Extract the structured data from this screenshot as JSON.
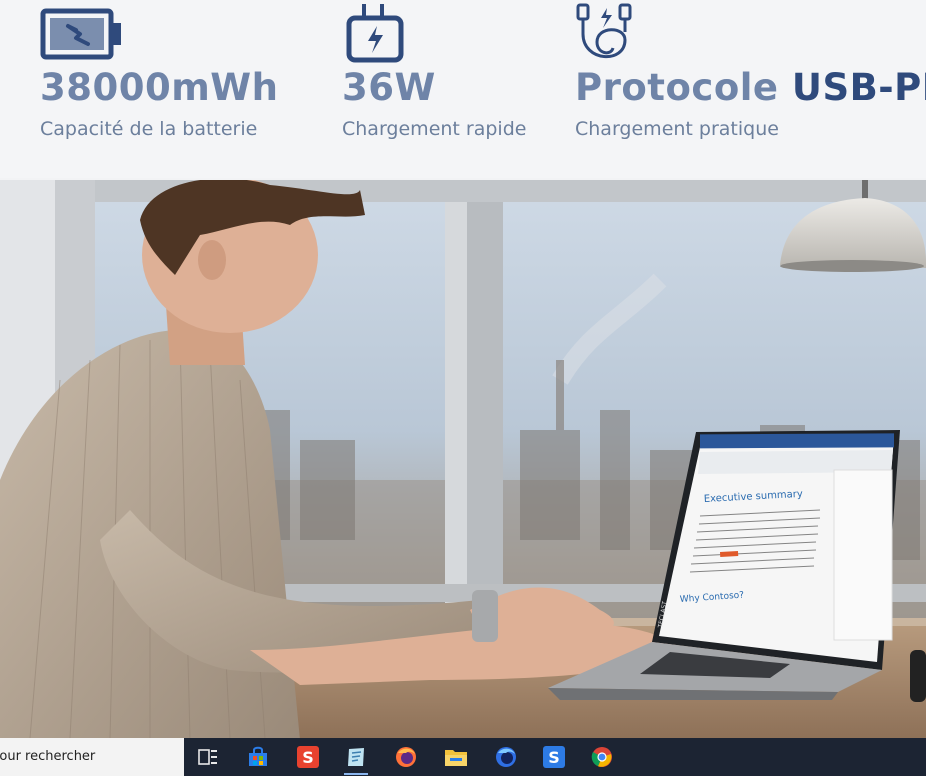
{
  "specs": [
    {
      "icon": "battery-icon",
      "value": "38000mWh",
      "caption": "Capacité de la batterie"
    },
    {
      "icon": "charger-plug-icon",
      "value": "36W",
      "caption": "Chargement rapide"
    },
    {
      "icon": "usb-cable-icon",
      "value_prefix": "Protocole ",
      "value_highlight": "USB-PD",
      "caption": "Chargement pratique"
    }
  ],
  "laptop_screen": {
    "heading": "Executive summary",
    "subheading": "Why Contoso?",
    "brand": "TECLAST"
  },
  "taskbar": {
    "search_text": "Pour rechercher",
    "apps": [
      {
        "name": "task-view-icon"
      },
      {
        "name": "store-icon"
      },
      {
        "name": "sogou-s-icon"
      },
      {
        "name": "notes-app-icon",
        "active": true
      },
      {
        "name": "firefox-icon"
      },
      {
        "name": "file-explorer-icon"
      },
      {
        "name": "firefox-nightly-icon"
      },
      {
        "name": "s-app-icon"
      },
      {
        "name": "chrome-icon"
      }
    ]
  },
  "colors": {
    "accent_dark": "#2f4a7c",
    "accent_light": "#6f84a8",
    "caption": "#6c7f9c",
    "taskbar": "#1c2433"
  }
}
